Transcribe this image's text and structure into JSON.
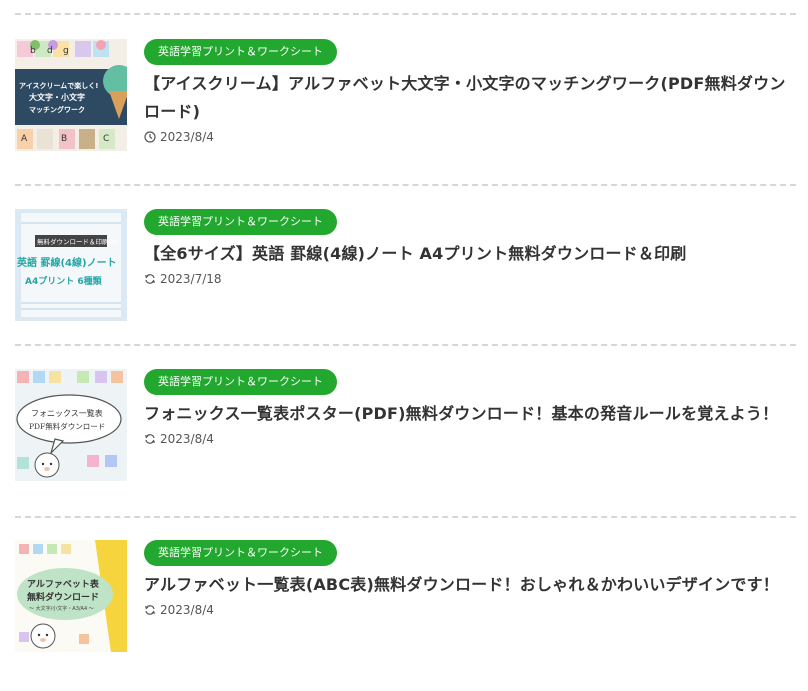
{
  "articles": [
    {
      "category": "英語学習プリント＆ワークシート",
      "title": "【アイスクリーム】アルファベット大文字・小文字のマッチングワーク(PDF無料ダウンロード)",
      "date_icon": "clock-icon",
      "date": "2023/8/4",
      "thumb": {
        "line1": "アイスクリームで楽しく!",
        "line2": "大文字・小文字",
        "line3": "マッチングワーク",
        "letters": [
          "b",
          "d",
          "g",
          "B",
          "A",
          "C"
        ],
        "colors": {
          "panel": "#2e4a63",
          "bg": "#f3efe6"
        }
      }
    },
    {
      "category": "英語学習プリント＆ワークシート",
      "title": "【全6サイズ】英語 罫線(4線)ノート A4プリント無料ダウンロード＆印刷",
      "date_icon": "refresh-icon",
      "date": "2023/7/18",
      "thumb": {
        "tag": "無料ダウンロード＆印刷OK",
        "line1": "英語 罫線(4線)ノート",
        "line2": "A4プリント 6種類",
        "colors": {
          "bg": "#dbe9f5",
          "text": "#26a6a6"
        }
      }
    },
    {
      "category": "英語学習プリント＆ワークシート",
      "title": "フォニックス一覧表ポスター(PDF)無料ダウンロード！基本の発音ルールを覚えよう！",
      "date_icon": "refresh-icon",
      "date": "2023/8/4",
      "thumb": {
        "line1": "フォニックス一覧表",
        "line2": "PDF無料ダウンロード",
        "colors": {
          "bg": "#eef3f6"
        }
      }
    },
    {
      "category": "英語学習プリント＆ワークシート",
      "title": "アルファベット一覧表(ABC表)無料ダウンロード！おしゃれ＆かわいいデザインです！",
      "date_icon": "refresh-icon",
      "date": "2023/8/4",
      "thumb": {
        "line1": "アルファベット表",
        "line2": "無料ダウンロード",
        "line3": "～ 大文字/小文字・A3/A4 ～",
        "colors": {
          "border": "#f5cf2a",
          "blob": "#bfe3c6"
        }
      }
    }
  ],
  "colors": {
    "category_bg": "#22a82e",
    "title_text": "#333333",
    "divider": "#d6d6d6"
  }
}
